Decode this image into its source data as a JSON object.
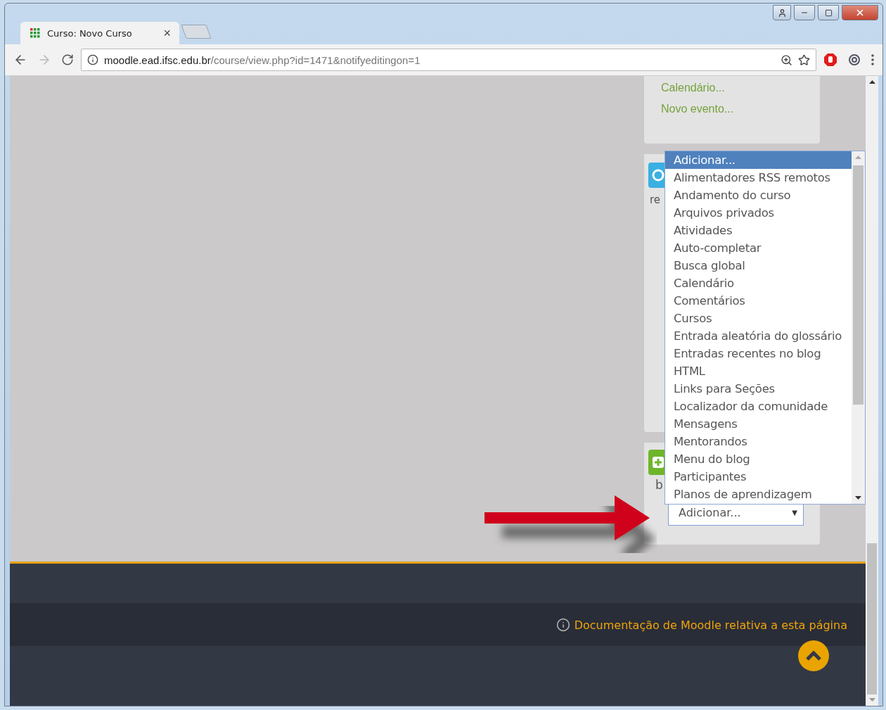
{
  "browser": {
    "tab": {
      "title": "Curso: Novo Curso",
      "close": "×",
      "selected": true
    },
    "address": {
      "host": "moodle.ead.ifsc.edu.br",
      "path": "/course/view.php?id=1471&notifyeditingon=1"
    }
  },
  "calendar_block": {
    "links": [
      "Calendário...",
      "Novo evento..."
    ]
  },
  "block_fragments": [
    {
      "text": "re"
    }
  ],
  "add_block": {
    "fragment": "b",
    "select": {
      "value": "Adicionar...",
      "caret": "▼"
    }
  },
  "dropdown": {
    "options": [
      {
        "label": "Adicionar...",
        "selected": true
      },
      {
        "label": "Alimentadores RSS remotos",
        "selected": false
      },
      {
        "label": "Andamento do curso",
        "selected": false
      },
      {
        "label": "Arquivos privados",
        "selected": false
      },
      {
        "label": "Atividades",
        "selected": false
      },
      {
        "label": "Auto-completar",
        "selected": false
      },
      {
        "label": "Busca global",
        "selected": false
      },
      {
        "label": "Calendário",
        "selected": false
      },
      {
        "label": "Comentários",
        "selected": false
      },
      {
        "label": "Cursos",
        "selected": false
      },
      {
        "label": "Entrada aleatória do glossário",
        "selected": false
      },
      {
        "label": "Entradas recentes no blog",
        "selected": false
      },
      {
        "label": "HTML",
        "selected": false
      },
      {
        "label": "Links para Seções",
        "selected": false
      },
      {
        "label": "Localizador da comunidade",
        "selected": false
      },
      {
        "label": "Mensagens",
        "selected": false
      },
      {
        "label": "Mentorandos",
        "selected": false
      },
      {
        "label": "Menu do blog",
        "selected": false
      },
      {
        "label": "Participantes",
        "selected": false
      },
      {
        "label": "Planos de aprendizagem",
        "selected": false
      }
    ]
  },
  "footer": {
    "doc_link": "Documentação de Moodle relativa a esta página"
  }
}
